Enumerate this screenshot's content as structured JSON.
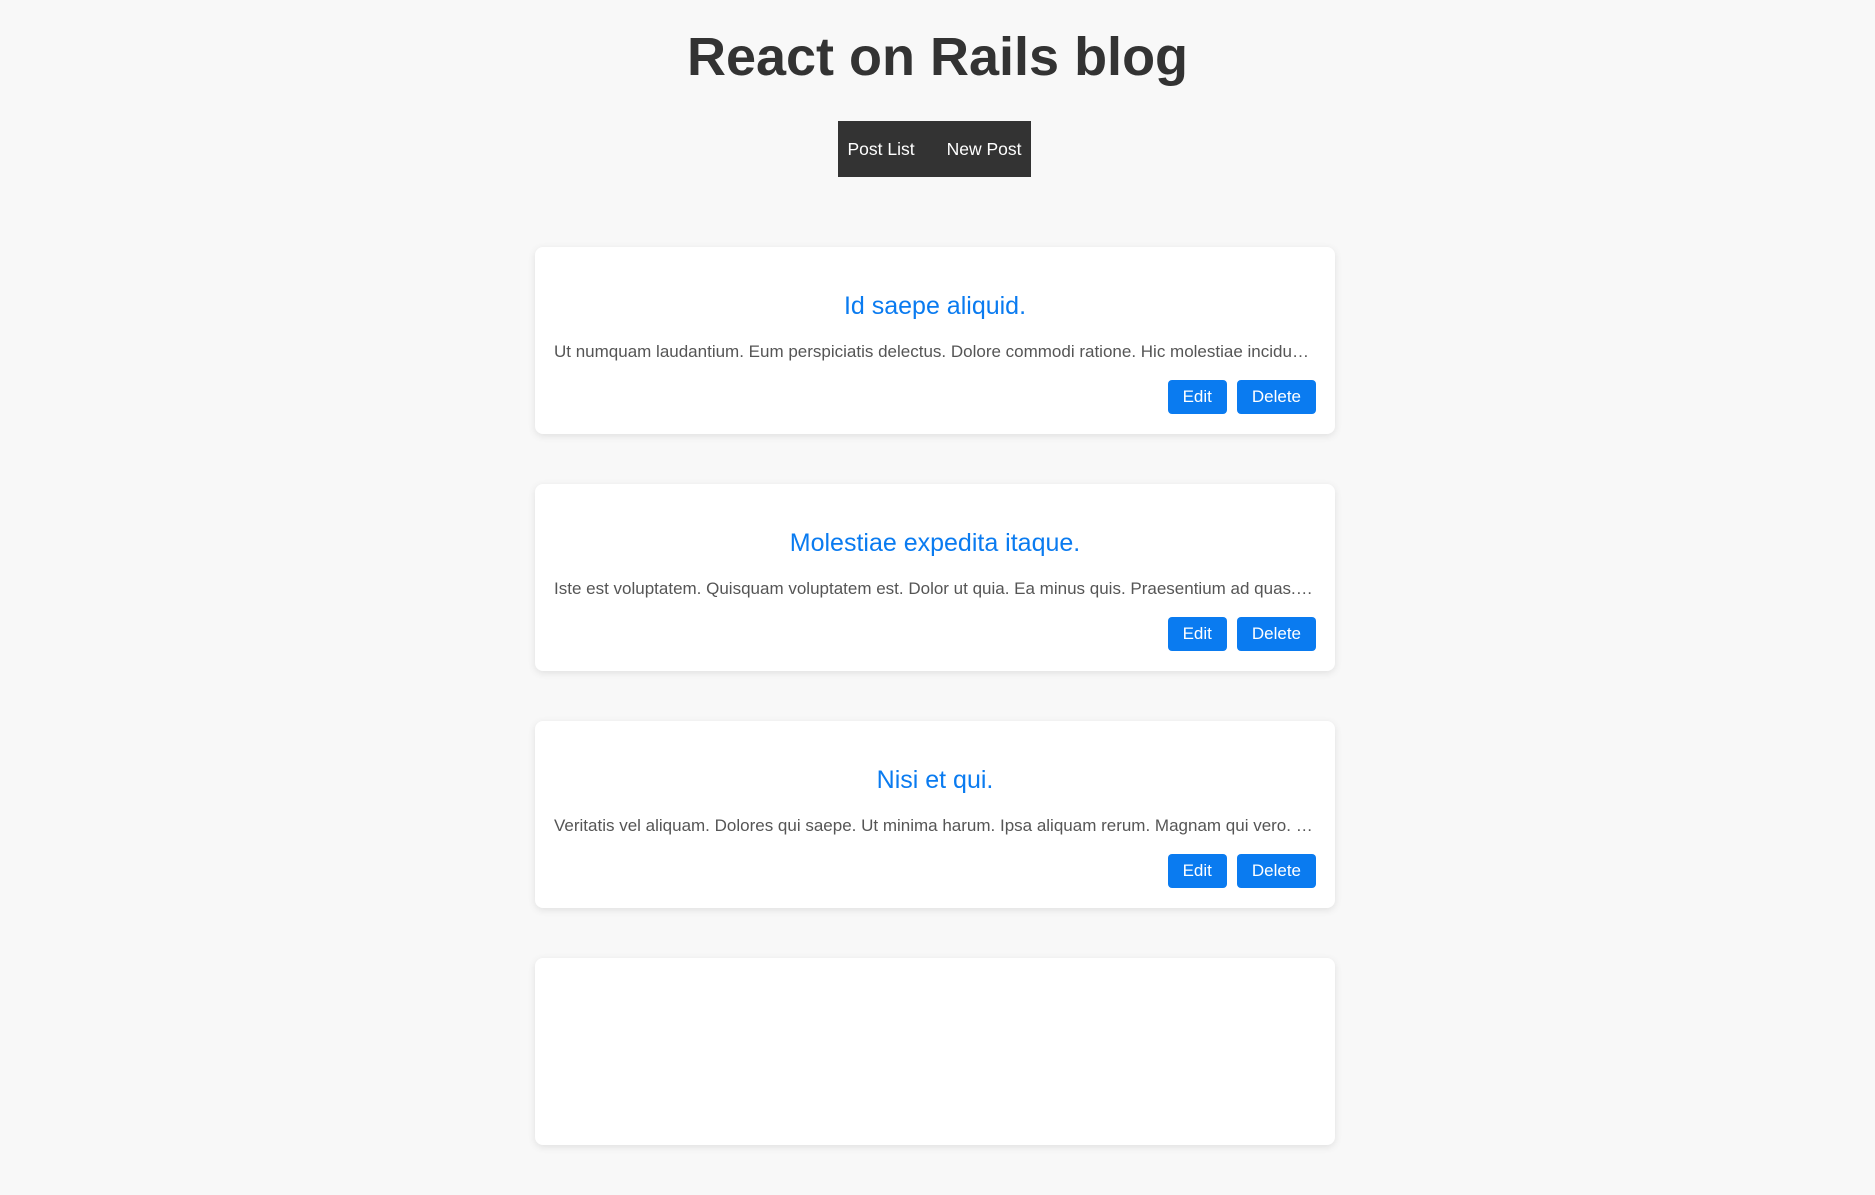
{
  "header": {
    "title": "React on Rails blog"
  },
  "nav": {
    "items": [
      {
        "label": "Post List"
      },
      {
        "label": "New Post"
      }
    ]
  },
  "posts": [
    {
      "title": "Id saepe aliquid.",
      "body": "Ut numquam laudantium. Eum perspiciatis delectus. Dolore commodi ratione. Hic molestiae incidunt. Arc…",
      "edit_label": "Edit",
      "delete_label": "Delete"
    },
    {
      "title": "Molestiae expedita itaque.",
      "body": "Iste est voluptatem. Quisquam voluptatem est. Dolor ut quia. Ea minus quis. Praesentium ad quas. Quid…",
      "edit_label": "Edit",
      "delete_label": "Delete"
    },
    {
      "title": "Nisi et qui.",
      "body": "Veritatis vel aliquam. Dolores qui saepe. Ut minima harum. Ipsa aliquam rerum. Magnam qui vero. Est po…",
      "edit_label": "Edit",
      "delete_label": "Delete"
    }
  ],
  "colors": {
    "accent": "#0a7bf0",
    "nav_background": "#333333",
    "page_background": "#f8f8f8"
  }
}
